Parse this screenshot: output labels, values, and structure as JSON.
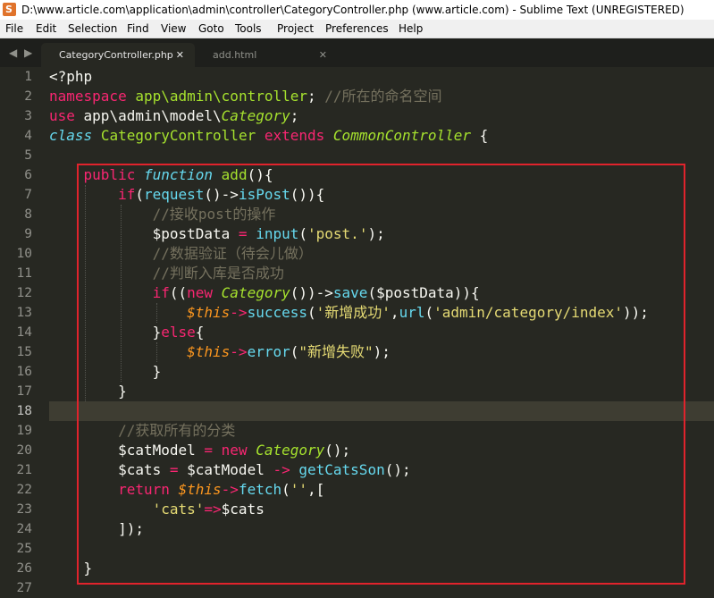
{
  "window": {
    "title": "D:\\www.article.com\\application\\admin\\controller\\CategoryController.php (www.article.com) - Sublime Text (UNREGISTERED)"
  },
  "menu": [
    "File",
    "Edit",
    "Selection",
    "Find",
    "View",
    "Goto",
    "Tools",
    "Project",
    "Preferences",
    "Help"
  ],
  "tab_nav": "◀ ▶",
  "tabs": [
    {
      "label": "CategoryController.php",
      "close": "✕"
    },
    {
      "label": "add.html",
      "close": "✕"
    }
  ],
  "line_numbers": [
    "1",
    "2",
    "3",
    "4",
    "5",
    "6",
    "7",
    "8",
    "9",
    "10",
    "11",
    "12",
    "13",
    "14",
    "15",
    "16",
    "17",
    "18",
    "19",
    "20",
    "21",
    "22",
    "23",
    "24",
    "25",
    "26",
    "27"
  ],
  "code": [
    [
      [
        "p",
        "<?php"
      ]
    ],
    [
      [
        "kw",
        "namespace"
      ],
      [
        "p",
        " "
      ],
      [
        "cls",
        "app\\admin\\controller"
      ],
      [
        "p",
        "; "
      ],
      [
        "cmt",
        "//所在的命名空间"
      ]
    ],
    [
      [
        "kw",
        "use"
      ],
      [
        "p",
        " app\\admin\\model\\"
      ],
      [
        "inh",
        "Category"
      ],
      [
        "p",
        ";"
      ]
    ],
    [
      [
        "it",
        "class"
      ],
      [
        "p",
        " "
      ],
      [
        "cls",
        "CategoryController"
      ],
      [
        "p",
        " "
      ],
      [
        "kw",
        "extends"
      ],
      [
        "p",
        " "
      ],
      [
        "inh",
        "CommonController"
      ],
      [
        "p",
        " {"
      ]
    ],
    [],
    [
      [
        "p",
        "    "
      ],
      [
        "kw",
        "public"
      ],
      [
        "p",
        " "
      ],
      [
        "it",
        "function"
      ],
      [
        "p",
        " "
      ],
      [
        "cls",
        "add"
      ],
      [
        "p",
        "(){"
      ]
    ],
    [
      [
        "p",
        "        "
      ],
      [
        "kw",
        "if"
      ],
      [
        "p",
        "("
      ],
      [
        "fn",
        "request"
      ],
      [
        "p",
        "()->"
      ],
      [
        "fn",
        "isPost"
      ],
      [
        "p",
        "()){"
      ]
    ],
    [
      [
        "p",
        "            "
      ],
      [
        "cmt",
        "//接收post的操作"
      ]
    ],
    [
      [
        "p",
        "            $postData "
      ],
      [
        "kw",
        "="
      ],
      [
        "p",
        " "
      ],
      [
        "fn",
        "input"
      ],
      [
        "p",
        "("
      ],
      [
        "str",
        "'post.'"
      ],
      [
        "p",
        ");"
      ]
    ],
    [
      [
        "p",
        "            "
      ],
      [
        "cmt",
        "//数据验证（待会儿做）"
      ]
    ],
    [
      [
        "p",
        "            "
      ],
      [
        "cmt",
        "//判断入库是否成功"
      ]
    ],
    [
      [
        "p",
        "            "
      ],
      [
        "kw",
        "if"
      ],
      [
        "p",
        "(("
      ],
      [
        "kw",
        "new"
      ],
      [
        "p",
        " "
      ],
      [
        "inh",
        "Category"
      ],
      [
        "p",
        "())->"
      ],
      [
        "fn",
        "save"
      ],
      [
        "p",
        "($postData)){"
      ]
    ],
    [
      [
        "p",
        "                "
      ],
      [
        "var",
        "$this"
      ],
      [
        "kw",
        "->"
      ],
      [
        "fn",
        "success"
      ],
      [
        "p",
        "("
      ],
      [
        "str",
        "'新增成功'"
      ],
      [
        "p",
        ","
      ],
      [
        "fn",
        "url"
      ],
      [
        "p",
        "("
      ],
      [
        "str",
        "'admin/category/index'"
      ],
      [
        "p",
        "));"
      ]
    ],
    [
      [
        "p",
        "            }"
      ],
      [
        "kw",
        "else"
      ],
      [
        "p",
        "{"
      ]
    ],
    [
      [
        "p",
        "                "
      ],
      [
        "var",
        "$this"
      ],
      [
        "kw",
        "->"
      ],
      [
        "fn",
        "error"
      ],
      [
        "p",
        "("
      ],
      [
        "str",
        "\"新增失败\""
      ],
      [
        "p",
        ");"
      ]
    ],
    [
      [
        "p",
        "            }"
      ]
    ],
    [
      [
        "p",
        "        }"
      ]
    ],
    [],
    [
      [
        "p",
        "        "
      ],
      [
        "cmt",
        "//获取所有的分类"
      ]
    ],
    [
      [
        "p",
        "        $catModel "
      ],
      [
        "kw",
        "="
      ],
      [
        "p",
        " "
      ],
      [
        "kw",
        "new"
      ],
      [
        "p",
        " "
      ],
      [
        "inh",
        "Category"
      ],
      [
        "p",
        "();"
      ]
    ],
    [
      [
        "p",
        "        $cats "
      ],
      [
        "kw",
        "="
      ],
      [
        "p",
        " $catModel "
      ],
      [
        "kw",
        "->"
      ],
      [
        "p",
        " "
      ],
      [
        "fn",
        "getCatsSon"
      ],
      [
        "p",
        "();"
      ]
    ],
    [
      [
        "p",
        "        "
      ],
      [
        "kw",
        "return"
      ],
      [
        "p",
        " "
      ],
      [
        "var",
        "$this"
      ],
      [
        "kw",
        "->"
      ],
      [
        "fn",
        "fetch"
      ],
      [
        "p",
        "("
      ],
      [
        "str",
        "''"
      ],
      [
        "p",
        ",["
      ]
    ],
    [
      [
        "p",
        "            "
      ],
      [
        "str",
        "'cats'"
      ],
      [
        "kw",
        "=>"
      ],
      [
        "p",
        "$cats"
      ]
    ],
    [
      [
        "p",
        "        ]);"
      ]
    ],
    [],
    [
      [
        "p",
        "    }"
      ]
    ],
    [
      [
        "p",
        " "
      ]
    ]
  ]
}
